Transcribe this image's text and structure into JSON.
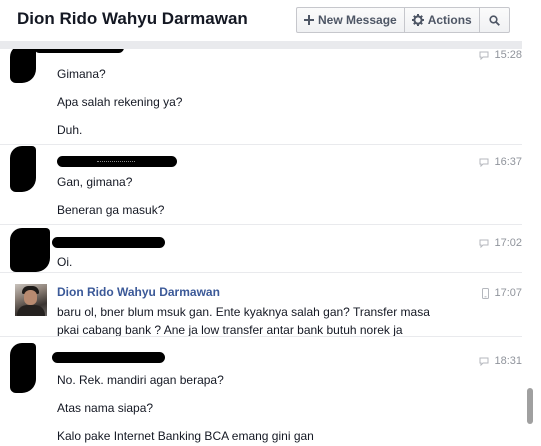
{
  "header": {
    "title": "Dion Rido Wahyu Darmawan",
    "new_message_label": "New Message",
    "actions_label": "Actions",
    "icons": {
      "new_message": "plus-icon",
      "actions": "gear-icon",
      "search": "search-icon"
    }
  },
  "conversation": {
    "groups": [
      {
        "sender": "",
        "time": "15:28",
        "messages": [
          "Gimana?",
          "Apa salah rekening ya?",
          "Duh."
        ]
      },
      {
        "sender": "",
        "time": "16:37",
        "messages": [
          "Gan, gimana?",
          "Beneran ga masuk?"
        ]
      },
      {
        "sender": "",
        "time": "17:02",
        "messages": [
          "Oi."
        ]
      },
      {
        "sender": "Dion Rido Wahyu Darmawan",
        "time": "17:07",
        "source_icon": "mobile-icon",
        "messages": [
          "baru ol, bner blum msuk gan. Ente kyaknya salah gan? Transfer masa",
          "pkai cabang bank ? Ane ja low transfer antar bank butuh norek ja"
        ]
      },
      {
        "sender": "",
        "time": "18:31",
        "messages": [
          "No. Rek. mandiri agan berapa?",
          "Atas nama siapa?",
          "Kalo pake Internet Banking BCA emang gini gan"
        ]
      }
    ]
  },
  "colors": {
    "sender_name": "#3b5998",
    "timestamp": "#90949c",
    "redaction": "#000000"
  }
}
